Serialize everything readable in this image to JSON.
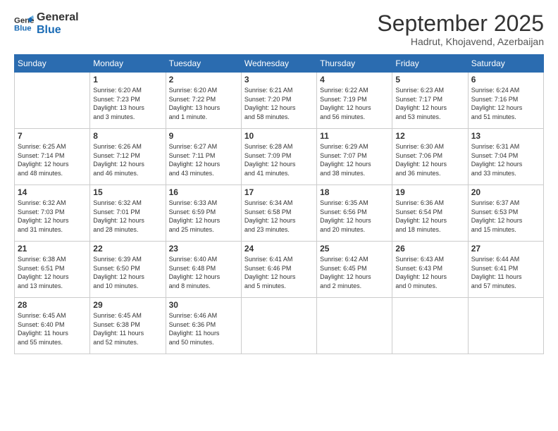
{
  "logo": {
    "line1": "General",
    "line2": "Blue"
  },
  "title": "September 2025",
  "subtitle": "Hadrut, Khojavend, Azerbaijan",
  "days_header": [
    "Sunday",
    "Monday",
    "Tuesday",
    "Wednesday",
    "Thursday",
    "Friday",
    "Saturday"
  ],
  "weeks": [
    [
      {
        "day": "",
        "info": ""
      },
      {
        "day": "1",
        "info": "Sunrise: 6:20 AM\nSunset: 7:23 PM\nDaylight: 13 hours\nand 3 minutes."
      },
      {
        "day": "2",
        "info": "Sunrise: 6:20 AM\nSunset: 7:22 PM\nDaylight: 13 hours\nand 1 minute."
      },
      {
        "day": "3",
        "info": "Sunrise: 6:21 AM\nSunset: 7:20 PM\nDaylight: 12 hours\nand 58 minutes."
      },
      {
        "day": "4",
        "info": "Sunrise: 6:22 AM\nSunset: 7:19 PM\nDaylight: 12 hours\nand 56 minutes."
      },
      {
        "day": "5",
        "info": "Sunrise: 6:23 AM\nSunset: 7:17 PM\nDaylight: 12 hours\nand 53 minutes."
      },
      {
        "day": "6",
        "info": "Sunrise: 6:24 AM\nSunset: 7:16 PM\nDaylight: 12 hours\nand 51 minutes."
      }
    ],
    [
      {
        "day": "7",
        "info": "Sunrise: 6:25 AM\nSunset: 7:14 PM\nDaylight: 12 hours\nand 48 minutes."
      },
      {
        "day": "8",
        "info": "Sunrise: 6:26 AM\nSunset: 7:12 PM\nDaylight: 12 hours\nand 46 minutes."
      },
      {
        "day": "9",
        "info": "Sunrise: 6:27 AM\nSunset: 7:11 PM\nDaylight: 12 hours\nand 43 minutes."
      },
      {
        "day": "10",
        "info": "Sunrise: 6:28 AM\nSunset: 7:09 PM\nDaylight: 12 hours\nand 41 minutes."
      },
      {
        "day": "11",
        "info": "Sunrise: 6:29 AM\nSunset: 7:07 PM\nDaylight: 12 hours\nand 38 minutes."
      },
      {
        "day": "12",
        "info": "Sunrise: 6:30 AM\nSunset: 7:06 PM\nDaylight: 12 hours\nand 36 minutes."
      },
      {
        "day": "13",
        "info": "Sunrise: 6:31 AM\nSunset: 7:04 PM\nDaylight: 12 hours\nand 33 minutes."
      }
    ],
    [
      {
        "day": "14",
        "info": "Sunrise: 6:32 AM\nSunset: 7:03 PM\nDaylight: 12 hours\nand 31 minutes."
      },
      {
        "day": "15",
        "info": "Sunrise: 6:32 AM\nSunset: 7:01 PM\nDaylight: 12 hours\nand 28 minutes."
      },
      {
        "day": "16",
        "info": "Sunrise: 6:33 AM\nSunset: 6:59 PM\nDaylight: 12 hours\nand 25 minutes."
      },
      {
        "day": "17",
        "info": "Sunrise: 6:34 AM\nSunset: 6:58 PM\nDaylight: 12 hours\nand 23 minutes."
      },
      {
        "day": "18",
        "info": "Sunrise: 6:35 AM\nSunset: 6:56 PM\nDaylight: 12 hours\nand 20 minutes."
      },
      {
        "day": "19",
        "info": "Sunrise: 6:36 AM\nSunset: 6:54 PM\nDaylight: 12 hours\nand 18 minutes."
      },
      {
        "day": "20",
        "info": "Sunrise: 6:37 AM\nSunset: 6:53 PM\nDaylight: 12 hours\nand 15 minutes."
      }
    ],
    [
      {
        "day": "21",
        "info": "Sunrise: 6:38 AM\nSunset: 6:51 PM\nDaylight: 12 hours\nand 13 minutes."
      },
      {
        "day": "22",
        "info": "Sunrise: 6:39 AM\nSunset: 6:50 PM\nDaylight: 12 hours\nand 10 minutes."
      },
      {
        "day": "23",
        "info": "Sunrise: 6:40 AM\nSunset: 6:48 PM\nDaylight: 12 hours\nand 8 minutes."
      },
      {
        "day": "24",
        "info": "Sunrise: 6:41 AM\nSunset: 6:46 PM\nDaylight: 12 hours\nand 5 minutes."
      },
      {
        "day": "25",
        "info": "Sunrise: 6:42 AM\nSunset: 6:45 PM\nDaylight: 12 hours\nand 2 minutes."
      },
      {
        "day": "26",
        "info": "Sunrise: 6:43 AM\nSunset: 6:43 PM\nDaylight: 12 hours\nand 0 minutes."
      },
      {
        "day": "27",
        "info": "Sunrise: 6:44 AM\nSunset: 6:41 PM\nDaylight: 11 hours\nand 57 minutes."
      }
    ],
    [
      {
        "day": "28",
        "info": "Sunrise: 6:45 AM\nSunset: 6:40 PM\nDaylight: 11 hours\nand 55 minutes."
      },
      {
        "day": "29",
        "info": "Sunrise: 6:45 AM\nSunset: 6:38 PM\nDaylight: 11 hours\nand 52 minutes."
      },
      {
        "day": "30",
        "info": "Sunrise: 6:46 AM\nSunset: 6:36 PM\nDaylight: 11 hours\nand 50 minutes."
      },
      {
        "day": "",
        "info": ""
      },
      {
        "day": "",
        "info": ""
      },
      {
        "day": "",
        "info": ""
      },
      {
        "day": "",
        "info": ""
      }
    ]
  ]
}
